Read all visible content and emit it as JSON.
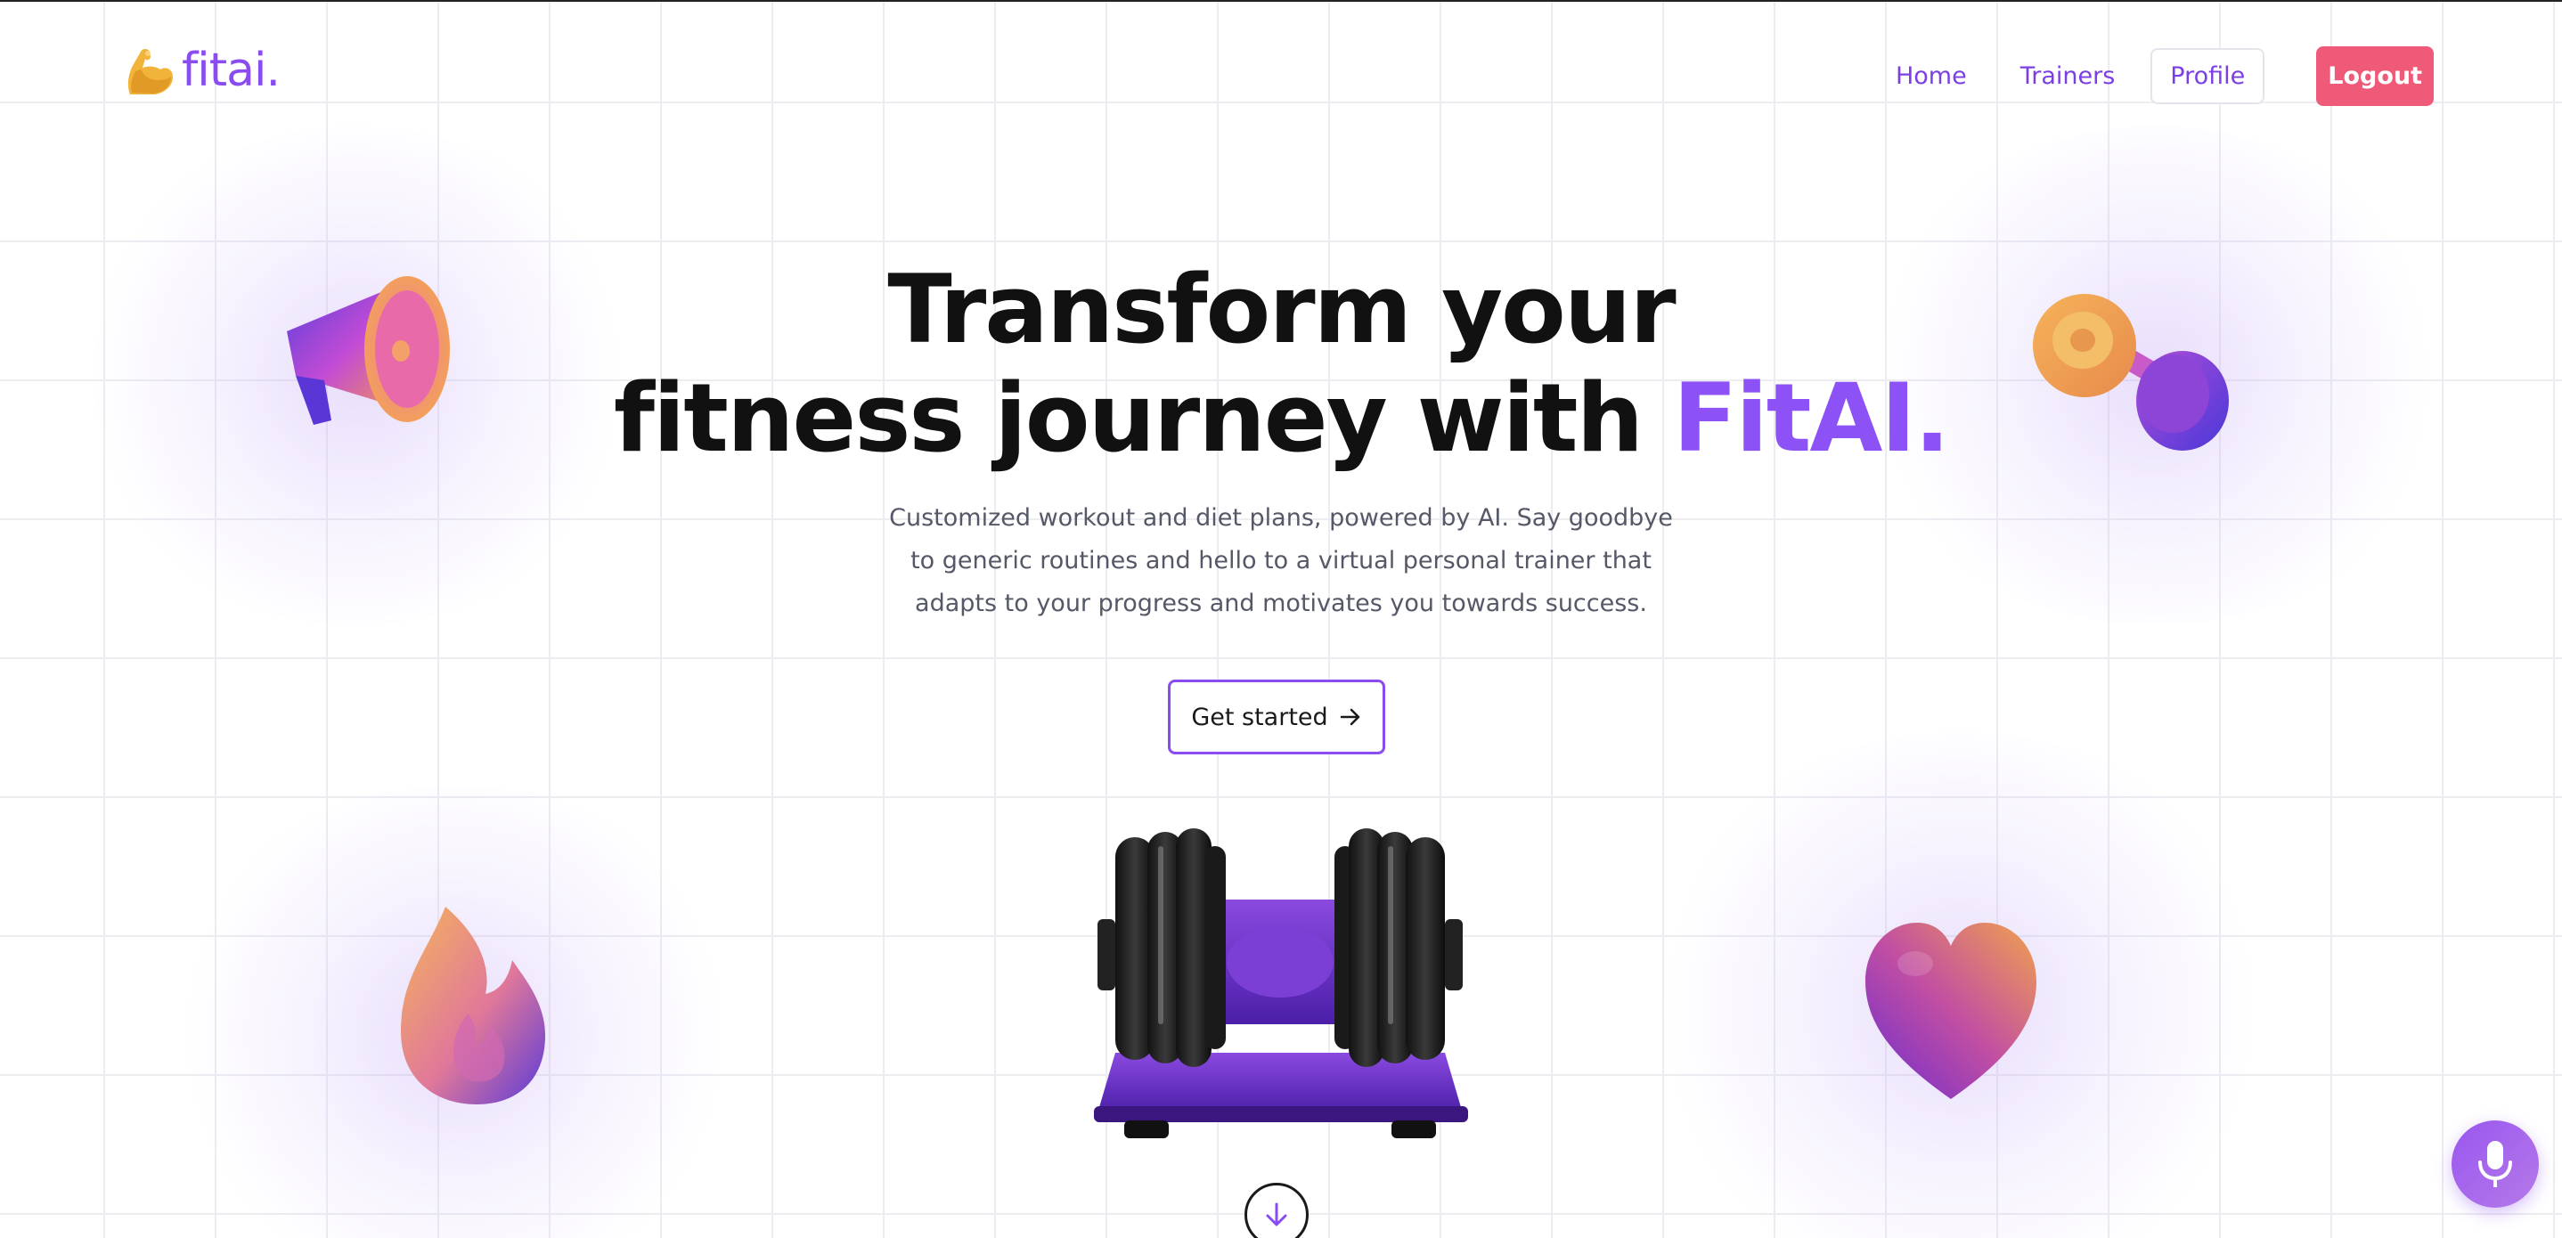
{
  "brand": {
    "logo_text": "fitai.",
    "logo_icon": "flexed-biceps-icon",
    "accent_color": "#8a4cf0"
  },
  "nav": {
    "home": "Home",
    "trainers": "Trainers",
    "profile": "Profile",
    "logout": "Logout",
    "logout_color": "#ef5a78"
  },
  "hero": {
    "title_line1": "Transform your",
    "title_line2_prefix": "fitness journey with ",
    "title_line2_accent": "FitAI.",
    "subtitle": "Customized workout and diet plans, powered by AI. Say goodbye to generic routines and hello to a virtual personal trainer that adapts to your progress and motivates you towards success.",
    "cta_label": "Get started",
    "cta_icon": "arrow-right-icon"
  },
  "decorations": [
    "megaphone-icon",
    "dumbbell-icon",
    "flame-icon",
    "heart-icon",
    "adjustable-dumbbell-image"
  ],
  "floating": {
    "scroll_icon": "arrow-down-icon",
    "mic_icon": "microphone-icon"
  }
}
